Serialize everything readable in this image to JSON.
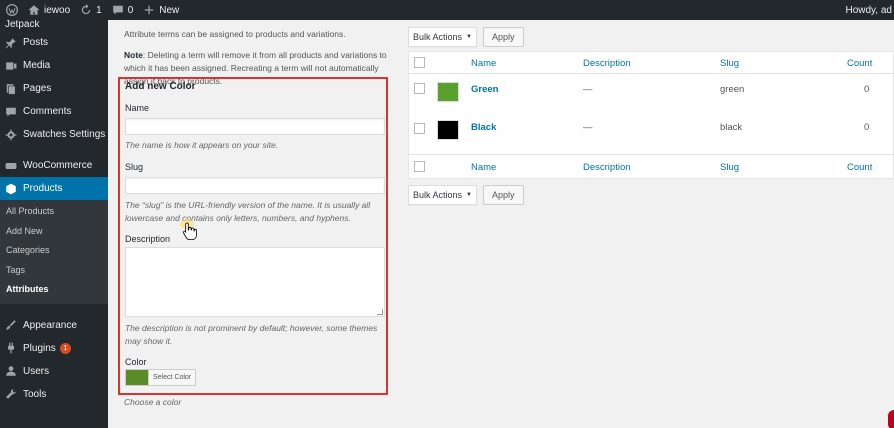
{
  "adminbar": {
    "site_name": "iewoo",
    "updates_count": "1",
    "comments_count": "0",
    "new_label": "New",
    "howdy": "Howdy, ad"
  },
  "sidebar": {
    "items": [
      {
        "label": "Jetpack",
        "icon": "jetpack-icon"
      },
      {
        "label": "Posts",
        "icon": "pin-icon"
      },
      {
        "label": "Media",
        "icon": "media-icon"
      },
      {
        "label": "Pages",
        "icon": "pages-icon"
      },
      {
        "label": "Comments",
        "icon": "comment-icon"
      },
      {
        "label": "Swatches Settings",
        "icon": "gear-icon"
      },
      {
        "label": "WooCommerce",
        "icon": "woo-icon"
      },
      {
        "label": "Products",
        "icon": "box-icon"
      }
    ],
    "submenu": [
      "All Products",
      "Add New",
      "Categories",
      "Tags",
      "Attributes"
    ],
    "bottom_items": [
      {
        "label": "Appearance",
        "icon": "brush-icon"
      },
      {
        "label": "Plugins",
        "icon": "plug-icon",
        "badge": "1"
      },
      {
        "label": "Users",
        "icon": "user-icon"
      },
      {
        "label": "Tools",
        "icon": "wrench-icon"
      }
    ]
  },
  "left": {
    "intro": "Attribute terms can be assigned to products and variations.",
    "note_label": "Note",
    "note_text": ": Deleting a term will remove it from all products and variations to which it has been assigned. Recreating a term will not automatically assign it back to products."
  },
  "form": {
    "title": "Add new Color",
    "name_label": "Name",
    "name_value": "",
    "name_help": "The name is how it appears on your site.",
    "slug_label": "Slug",
    "slug_value": "",
    "slug_help": "The “slug” is the URL-friendly version of the name. It is usually all lowercase and contains only letters, numbers, and hyphens.",
    "description_label": "Description",
    "description_value": "",
    "description_help": "The description is not prominent by default; however, some themes may show it.",
    "color_label": "Color",
    "select_color": "Select Color",
    "color_value": "#5b8c2a",
    "choose_help": "Choose a color"
  },
  "table": {
    "bulk_actions": "Bulk Actions",
    "apply": "Apply",
    "headers": [
      "Name",
      "Description",
      "Slug",
      "Count"
    ],
    "rows": [
      {
        "name": "Green",
        "description": "—",
        "slug": "green",
        "count": "0",
        "color": "#5aa02c"
      },
      {
        "name": "Black",
        "description": "—",
        "slug": "black",
        "count": "0",
        "color": "#000000"
      }
    ]
  },
  "colors": {
    "admin_dark": "#23282d",
    "accent": "#0073aa",
    "highlight_border": "#dc3232"
  }
}
